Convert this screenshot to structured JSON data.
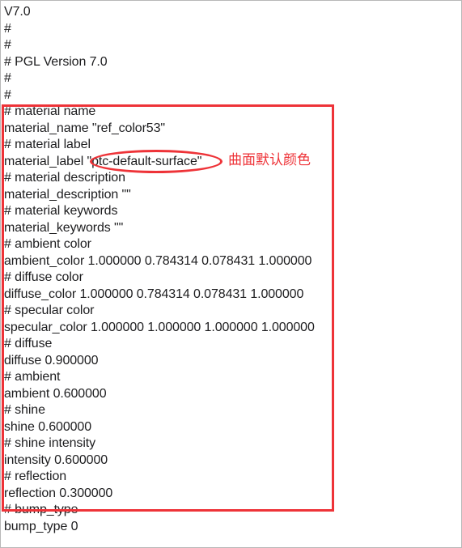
{
  "document": {
    "kind": "plain-text-file-view",
    "lines": [
      "V7.0",
      "#",
      "#",
      "# PGL Version 7.0",
      "#",
      "#",
      "# material name",
      "material_name \"ref_color53\"",
      "# material label",
      "material_label \"ptc-default-surface\"",
      "# material description",
      "material_description \"\"",
      "# material keywords",
      "material_keywords \"\"",
      "# ambient color",
      "ambient_color 1.000000 0.784314 0.078431 1.000000",
      "# diffuse color",
      "diffuse_color 1.000000 0.784314 0.078431 1.000000",
      "# specular color",
      "specular_color 1.000000 1.000000 1.000000 1.000000",
      "# diffuse",
      "diffuse 0.900000",
      "# ambient",
      "ambient 0.600000",
      "# shine",
      "shine 0.600000",
      "# shine intensity",
      "intensity 0.600000",
      "# reflection",
      "reflection 0.300000",
      "# bump_type",
      "bump_type 0"
    ]
  },
  "annotations": {
    "color": "#ee3338",
    "highlight_rect": {
      "label": "material-properties-block-highlight",
      "covers_lines_from": "# material name",
      "covers_lines_to": "reflection 0.300000"
    },
    "ellipse": {
      "label": "material-label-value-circle",
      "circled_value": "\"ptc-default-surface\""
    },
    "note": {
      "text": "曲面默认颜色"
    }
  }
}
